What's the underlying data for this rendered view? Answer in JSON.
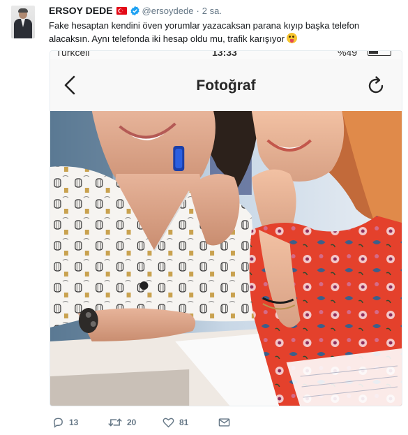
{
  "tweet": {
    "display_name": "ERSOY DEDE",
    "handle": "@ersoydede",
    "separator": "·",
    "time": "2 sa.",
    "text": "Fake hesaptan kendini öven yorumlar yazacaksan parana kıyıp başka telefon alacaksın. Aynı telefonda iki hesap oldu mu, trafik karışıyor"
  },
  "embedded_screenshot": {
    "carrier": "Turkcell",
    "clock": "13:33",
    "battery": "%49",
    "nav_title": "Fotoğraf"
  },
  "actions": {
    "reply_count": "13",
    "retweet_count": "20",
    "like_count": "81"
  },
  "icons": {
    "verified": "verified-badge-icon",
    "flag": "turkey-flag-icon",
    "emoji": "winking-tongue-emoji",
    "reply": "reply-icon",
    "retweet": "retweet-icon",
    "like": "heart-icon",
    "dm": "envelope-icon"
  },
  "colors": {
    "text": "#14171a",
    "secondary": "#657786",
    "verified": "#1da1f2",
    "flag": "#e30a17"
  }
}
